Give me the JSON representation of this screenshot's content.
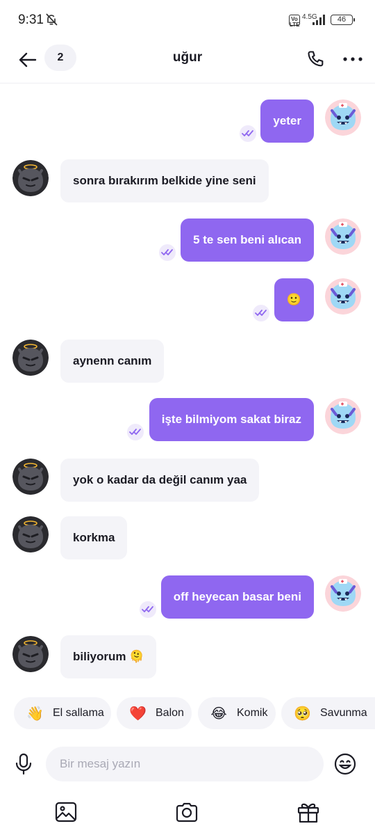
{
  "status_bar": {
    "time": "9:31",
    "volte": "Vo LTE",
    "network": "4.5G",
    "battery": "46"
  },
  "header": {
    "unread_count": "2",
    "title": "uğur"
  },
  "messages": [
    {
      "direction": "out",
      "text": "yeter",
      "read": true
    },
    {
      "direction": "in",
      "text": "sonra bırakırım belkide yine seni"
    },
    {
      "direction": "out",
      "text": "5 te sen beni alıcan",
      "read": true
    },
    {
      "direction": "out",
      "text": "🙂",
      "read": true
    },
    {
      "direction": "in",
      "text": "aynenn canım"
    },
    {
      "direction": "out",
      "text": "işte bilmiyom sakat biraz",
      "read": true
    },
    {
      "direction": "in",
      "text": "yok o kadar da değil canım yaa"
    },
    {
      "direction": "in",
      "text": "korkma"
    },
    {
      "direction": "out",
      "text": "off heyecan basar beni",
      "read": true
    },
    {
      "direction": "in",
      "text": "biliyorum 🫠"
    }
  ],
  "reactions": [
    {
      "emoji": "👋",
      "label": "El sallama"
    },
    {
      "emoji": "❤️",
      "label": "Balon"
    },
    {
      "emoji": "😂",
      "label": "Komik"
    },
    {
      "emoji": "🥺",
      "label": "Savunma"
    }
  ],
  "composer": {
    "placeholder": "Bir mesaj yazın",
    "value": ""
  },
  "icons": {
    "back": "arrow-left-icon",
    "call": "phone-icon",
    "more": "more-horizontal-icon",
    "mic": "microphone-icon",
    "emoji": "smiley-icon",
    "gallery": "image-icon",
    "camera": "camera-icon",
    "gift": "gift-icon",
    "read_receipt": "double-check-icon"
  },
  "colors": {
    "accent": "#8f67f0",
    "bubble_in": "#f4f4f8",
    "text": "#1b1b24"
  }
}
